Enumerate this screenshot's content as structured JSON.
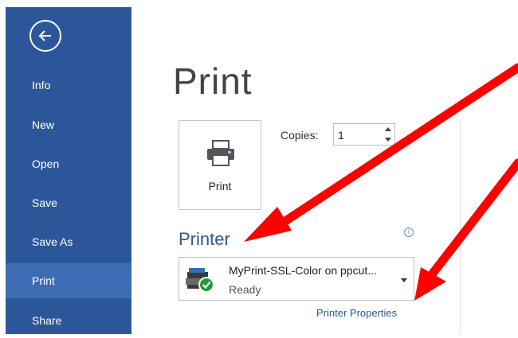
{
  "sidebar": {
    "items": [
      {
        "id": "info",
        "label": "Info"
      },
      {
        "id": "new",
        "label": "New"
      },
      {
        "id": "open",
        "label": "Open"
      },
      {
        "id": "save",
        "label": "Save"
      },
      {
        "id": "save-as",
        "label": "Save As"
      },
      {
        "id": "print",
        "label": "Print",
        "active": true
      },
      {
        "id": "share",
        "label": "Share"
      }
    ],
    "back_icon": "back-arrow-icon"
  },
  "main": {
    "title": "Print",
    "print_button_label": "Print",
    "copies_label": "Copies:",
    "copies_value": "1",
    "printer_heading": "Printer",
    "printer_name": "MyPrint-SSL-Color on ppcut...",
    "printer_status": "Ready",
    "printer_properties_link": "Printer Properties"
  },
  "colors": {
    "sidebar_bg": "#2b579a",
    "sidebar_active": "#3e6db5",
    "accent": "#2b579a",
    "annotation_arrow": "#ff0000",
    "ready_badge": "#1e9e3a"
  }
}
